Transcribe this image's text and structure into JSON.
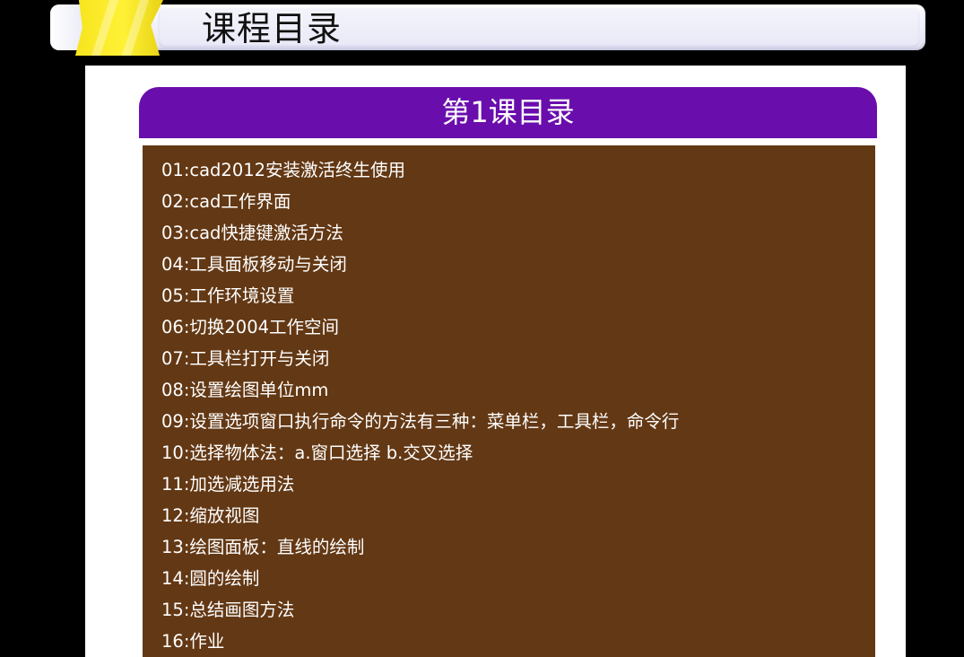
{
  "header": {
    "title": "课程目录"
  },
  "lesson": {
    "title": "第1课目录",
    "items": [
      "01:cad2012安装激活终生使用",
      "02:cad工作界面",
      "03:cad快捷键激活方法",
      "04:工具面板移动与关闭",
      "05:工作环境设置",
      "06:切换2004工作空间",
      "07:工具栏打开与关闭",
      "08:设置绘图单位mm",
      "09:设置选项窗口执行命令的方法有三种：菜单栏，工具栏，命令行",
      "10:选择物体法：a.窗口选择  b.交叉选择",
      "11:加选减选用法",
      "12:缩放视图",
      "13:绘图面板：直线的绘制",
      "14:圆的绘制",
      "15:总结画图方法",
      "16:作业"
    ]
  },
  "colors": {
    "background": "#000000",
    "banner_accent": "#f7e41e",
    "lesson_header": "#6a0dad",
    "lesson_box": "#633814",
    "text_light": "#ffffff"
  }
}
